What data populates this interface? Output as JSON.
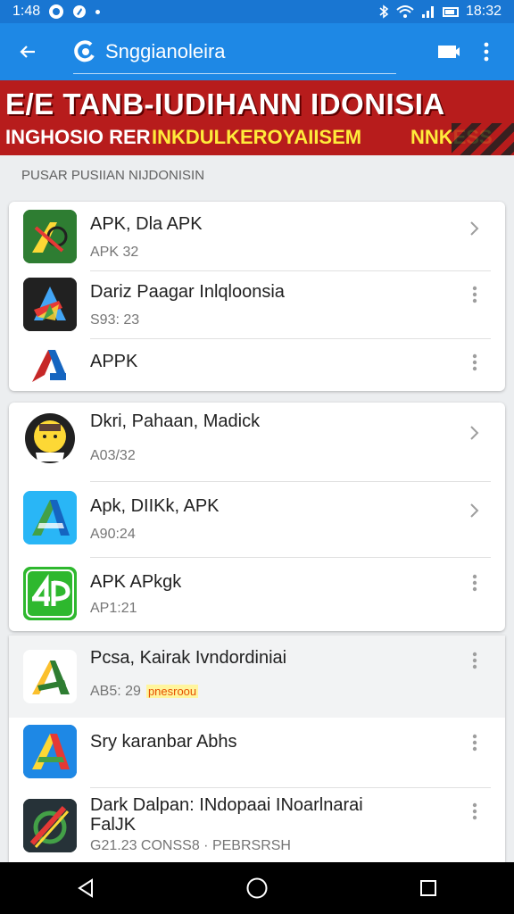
{
  "status_bar": {
    "time_left": "1:48",
    "time_right": "18:32"
  },
  "app_bar": {
    "title": "Snggianoleira"
  },
  "banner": {
    "line1": "E/E TANB-IUDIHANN IDONISIA",
    "line2_a": "INGHOSIO RER",
    "line2_b": "INKDULKEROYAIISEM",
    "line2_c": "NNKESS"
  },
  "section": {
    "label": "PUSAR PUSIIAN NIJDONISIN"
  },
  "cards": [
    {
      "rows": [
        {
          "name": "APK, Dla APK",
          "sub": "APK 32",
          "trail": "chevron"
        },
        {
          "name": "Dariz Paagar Inlqloonsia",
          "sub": "S93: 23",
          "trail": "more"
        },
        {
          "name": "APPK",
          "sub": "",
          "trail": "more"
        }
      ]
    },
    {
      "rows": [
        {
          "name": "Dkri, Pahaan, Madick",
          "sub": "A03/32",
          "trail": "chevron"
        },
        {
          "name": "Apk, DIIKk, APK",
          "sub": "A90:24",
          "trail": "chevron"
        },
        {
          "name": "APK APkgk",
          "sub": "AP1:21",
          "trail": "more"
        }
      ]
    },
    {
      "rows": [
        {
          "name": "Pcsa, Kairak Ivndordiniai",
          "sub": "AB5: 29",
          "tag": "pnesroou",
          "trail": "more"
        },
        {
          "name": "Sry karanbar Abhs",
          "sub": "",
          "trail": "more"
        },
        {
          "name": "Dark Dalpan: INdopaai INoarlnarai",
          "name2": "FalJK",
          "sub": "G21.23 CONSS8 · PEBRSRSH",
          "trail": "more"
        }
      ]
    }
  ],
  "colors": {
    "primary": "#1e88e5",
    "status": "#1976d2",
    "banner_red": "#b71c1c",
    "banner_yellow": "#ffeb3b"
  }
}
